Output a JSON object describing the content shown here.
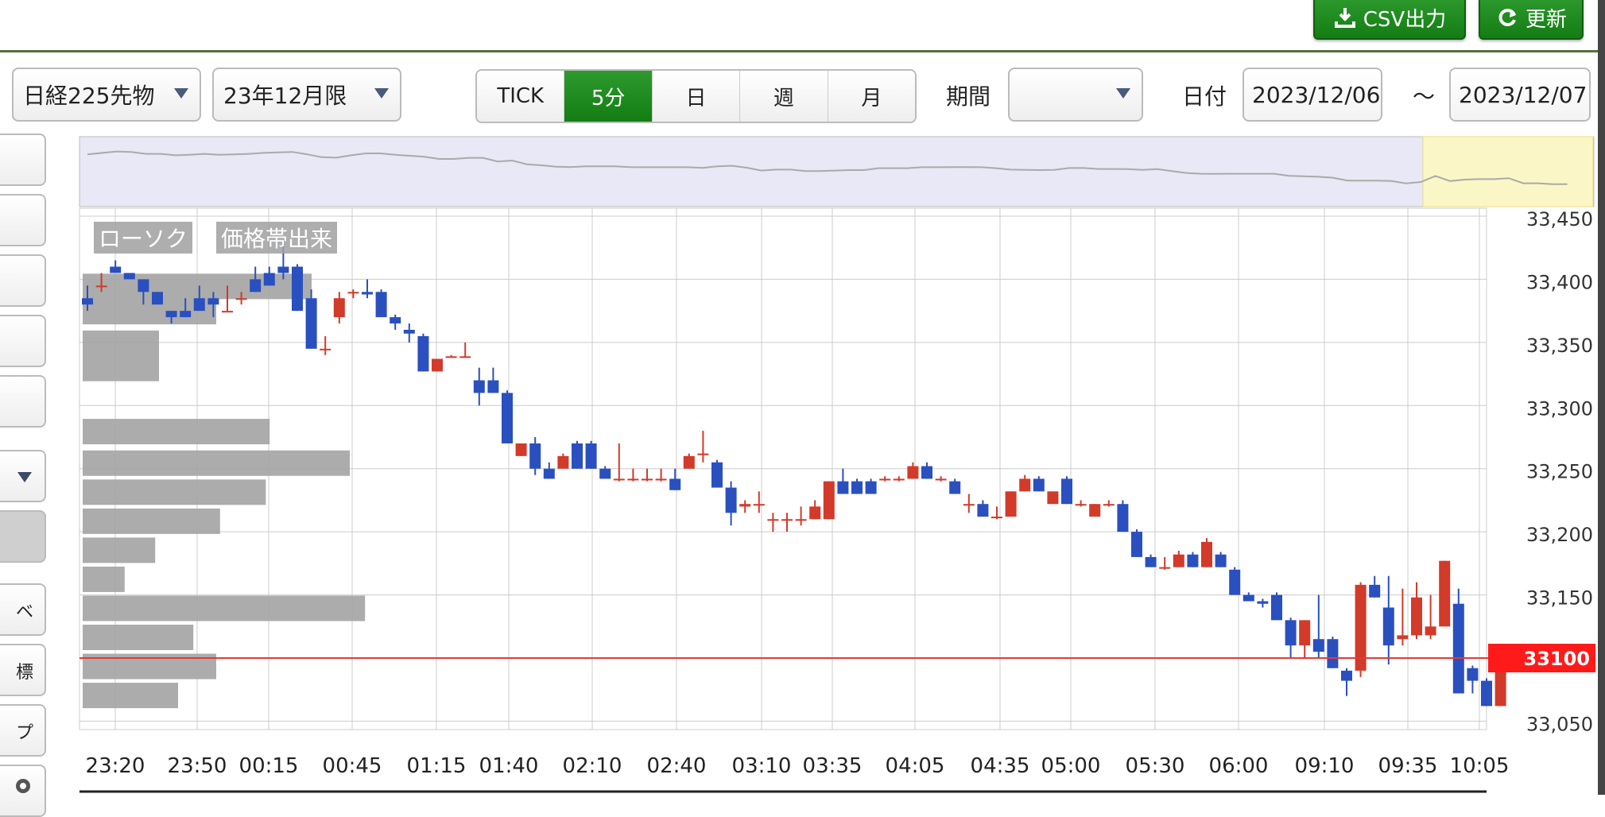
{
  "toolbar": {
    "csv_label": "CSV出力",
    "refresh_label": "更新",
    "symbol": "日経225先物",
    "contract": "23年12月限",
    "intervals": [
      "TICK",
      "5分",
      "日",
      "週",
      "月"
    ],
    "active_interval": "5分",
    "period_label": "期間",
    "period_value": "",
    "date_label": "日付",
    "date_from": "2023/12/06",
    "date_sep": "～",
    "date_to": "2023/12/07"
  },
  "sidebar": {
    "partial_labels": [
      "ベ",
      "標",
      "プ"
    ]
  },
  "legend": {
    "candle_label": "ローソク",
    "volume_label": "価格帯出来"
  },
  "colors": {
    "up": "#d23a2a",
    "down": "#2a4fbf",
    "price_line": "#e23a3a",
    "accent": "#1e8a1e"
  },
  "chart_data": {
    "type": "candlestick",
    "ylim": [
      33040,
      33460
    ],
    "y_ticks": [
      "33,450",
      "33,400",
      "33,350",
      "33,300",
      "33,250",
      "33,200",
      "33,150",
      "33,100",
      "33,050"
    ],
    "y_tick_values": [
      33450,
      33400,
      33350,
      33300,
      33250,
      33200,
      33150,
      33100,
      33050
    ],
    "x_tick_labels": [
      "23:20",
      "23:50",
      "00:15",
      "00:45",
      "01:15",
      "01:40",
      "02:10",
      "02:40",
      "03:10",
      "03:35",
      "04:05",
      "04:35",
      "05:00",
      "05:30",
      "06:00",
      "09:10",
      "09:35",
      "10:05"
    ],
    "current_price": "33100",
    "current_price_value": 33100,
    "candles": [
      [
        33385,
        33395,
        33380,
        33375
      ],
      [
        33395,
        33405,
        33395,
        33390
      ],
      [
        33410,
        33415,
        33405,
        33405
      ],
      [
        33405,
        33405,
        33400,
        33400
      ],
      [
        33400,
        33400,
        33390,
        33380
      ],
      [
        33390,
        33390,
        33380,
        33380
      ],
      [
        33375,
        33375,
        33370,
        33365
      ],
      [
        33375,
        33385,
        33370,
        33370
      ],
      [
        33385,
        33395,
        33375,
        33380
      ],
      [
        33385,
        33390,
        33380,
        33370
      ],
      [
        33375,
        33395,
        33375,
        33375
      ],
      [
        33385,
        33390,
        33385,
        33380
      ],
      [
        33400,
        33410,
        33390,
        33390
      ],
      [
        33405,
        33410,
        33395,
        33395
      ],
      [
        33410,
        33430,
        33405,
        33400
      ],
      [
        33410,
        33412,
        33375,
        33375
      ],
      [
        33385,
        33392,
        33345,
        33345
      ],
      [
        33345,
        33355,
        33345,
        33340
      ],
      [
        33370,
        33390,
        33385,
        33365
      ],
      [
        33390,
        33392,
        33390,
        33385
      ],
      [
        33390,
        33400,
        33388,
        33385
      ],
      [
        33390,
        33392,
        33370,
        33370
      ],
      [
        33370,
        33372,
        33365,
        33360
      ],
      [
        33360,
        33365,
        33357,
        33350
      ],
      [
        33355,
        33357,
        33327,
        33327
      ],
      [
        33327,
        33337,
        33337,
        33327
      ],
      [
        33339,
        33340,
        33339,
        33338
      ],
      [
        33339,
        33350,
        33339,
        33338
      ],
      [
        33320,
        33330,
        33310,
        33300
      ],
      [
        33320,
        33330,
        33310,
        33310
      ],
      [
        33310,
        33312,
        33270,
        33270
      ],
      [
        33260,
        33270,
        33270,
        33260
      ],
      [
        33270,
        33275,
        33250,
        33245
      ],
      [
        33250,
        33255,
        33242,
        33242
      ],
      [
        33250,
        33262,
        33260,
        33250
      ],
      [
        33270,
        33272,
        33250,
        33250
      ],
      [
        33270,
        33272,
        33250,
        33250
      ],
      [
        33250,
        33252,
        33242,
        33242
      ],
      [
        33242,
        33270,
        33242,
        33240
      ],
      [
        33242,
        33250,
        33242,
        33240
      ],
      [
        33242,
        33250,
        33242,
        33240
      ],
      [
        33242,
        33250,
        33242,
        33240
      ],
      [
        33242,
        33250,
        33233,
        33233
      ],
      [
        33250,
        33262,
        33260,
        33250
      ],
      [
        33262,
        33280,
        33262,
        33255
      ],
      [
        33255,
        33257,
        33235,
        33235
      ],
      [
        33235,
        33240,
        33215,
        33205
      ],
      [
        33220,
        33225,
        33222,
        33215
      ],
      [
        33222,
        33232,
        33222,
        33215
      ],
      [
        33210,
        33215,
        33210,
        33200
      ],
      [
        33210,
        33215,
        33210,
        33200
      ],
      [
        33210,
        33220,
        33210,
        33205
      ],
      [
        33210,
        33225,
        33220,
        33210
      ],
      [
        33210,
        33240,
        33240,
        33210
      ],
      [
        33240,
        33250,
        33230,
        33230
      ],
      [
        33240,
        33242,
        33230,
        33230
      ],
      [
        33240,
        33242,
        33230,
        33230
      ],
      [
        33242,
        33244,
        33242,
        33240
      ],
      [
        33242,
        33244,
        33242,
        33240
      ],
      [
        33242,
        33255,
        33252,
        33242
      ],
      [
        33252,
        33255,
        33242,
        33242
      ],
      [
        33242,
        33244,
        33242,
        33240
      ],
      [
        33240,
        33242,
        33230,
        33230
      ],
      [
        33222,
        33230,
        33222,
        33215
      ],
      [
        33222,
        33225,
        33212,
        33212
      ],
      [
        33212,
        33220,
        33212,
        33210
      ],
      [
        33212,
        33220,
        33232,
        33212
      ],
      [
        33232,
        33245,
        33242,
        33232
      ],
      [
        33242,
        33244,
        33232,
        33232
      ],
      [
        33222,
        33232,
        33232,
        33222
      ],
      [
        33242,
        33244,
        33222,
        33222
      ],
      [
        33222,
        33225,
        33222,
        33220
      ],
      [
        33212,
        33222,
        33222,
        33212
      ],
      [
        33222,
        33225,
        33222,
        33220
      ],
      [
        33222,
        33225,
        33200,
        33200
      ],
      [
        33200,
        33202,
        33180,
        33180
      ],
      [
        33180,
        33182,
        33172,
        33172
      ],
      [
        33172,
        33180,
        33172,
        33170
      ],
      [
        33172,
        33185,
        33182,
        33172
      ],
      [
        33182,
        33184,
        33172,
        33172
      ],
      [
        33172,
        33195,
        33192,
        33172
      ],
      [
        33182,
        33184,
        33172,
        33172
      ],
      [
        33170,
        33172,
        33150,
        33150
      ],
      [
        33150,
        33152,
        33145,
        33145
      ],
      [
        33145,
        33147,
        33143,
        33140
      ],
      [
        33150,
        33152,
        33130,
        33130
      ],
      [
        33130,
        33132,
        33110,
        33100
      ],
      [
        33110,
        33112,
        33130,
        33100
      ],
      [
        33115,
        33150,
        33105,
        33100
      ],
      [
        33115,
        33117,
        33092,
        33095
      ],
      [
        33090,
        33092,
        33082,
        33070
      ],
      [
        33090,
        33160,
        33158,
        33085
      ],
      [
        33158,
        33165,
        33148,
        33148
      ],
      [
        33140,
        33165,
        33110,
        33095
      ],
      [
        33115,
        33155,
        33118,
        33110
      ],
      [
        33118,
        33160,
        33148,
        33115
      ],
      [
        33118,
        33150,
        33125,
        33115
      ],
      [
        33125,
        33172,
        33177,
        33125
      ],
      [
        33143,
        33155,
        33072,
        33072
      ],
      [
        33092,
        33094,
        33082,
        33072
      ],
      [
        33082,
        33084,
        33062,
        33062
      ],
      [
        33062,
        33095,
        33092,
        33062
      ]
    ],
    "volume_profile": [
      {
        "price": 33395,
        "volume": 0.6
      },
      {
        "price": 33375,
        "volume": 0.35
      },
      {
        "price": 33350,
        "volume": 0.2
      },
      {
        "price": 33330,
        "volume": 0.2
      },
      {
        "price": 33280,
        "volume": 0.49
      },
      {
        "price": 33255,
        "volume": 0.7
      },
      {
        "price": 33232,
        "volume": 0.48
      },
      {
        "price": 33209,
        "volume": 0.36
      },
      {
        "price": 33186,
        "volume": 0.19
      },
      {
        "price": 33163,
        "volume": 0.11
      },
      {
        "price": 33140,
        "volume": 0.74
      },
      {
        "price": 33117,
        "volume": 0.29
      },
      {
        "price": 33094,
        "volume": 0.35
      },
      {
        "price": 33071,
        "volume": 0.25
      }
    ],
    "grid": true,
    "legend": "top-left"
  }
}
